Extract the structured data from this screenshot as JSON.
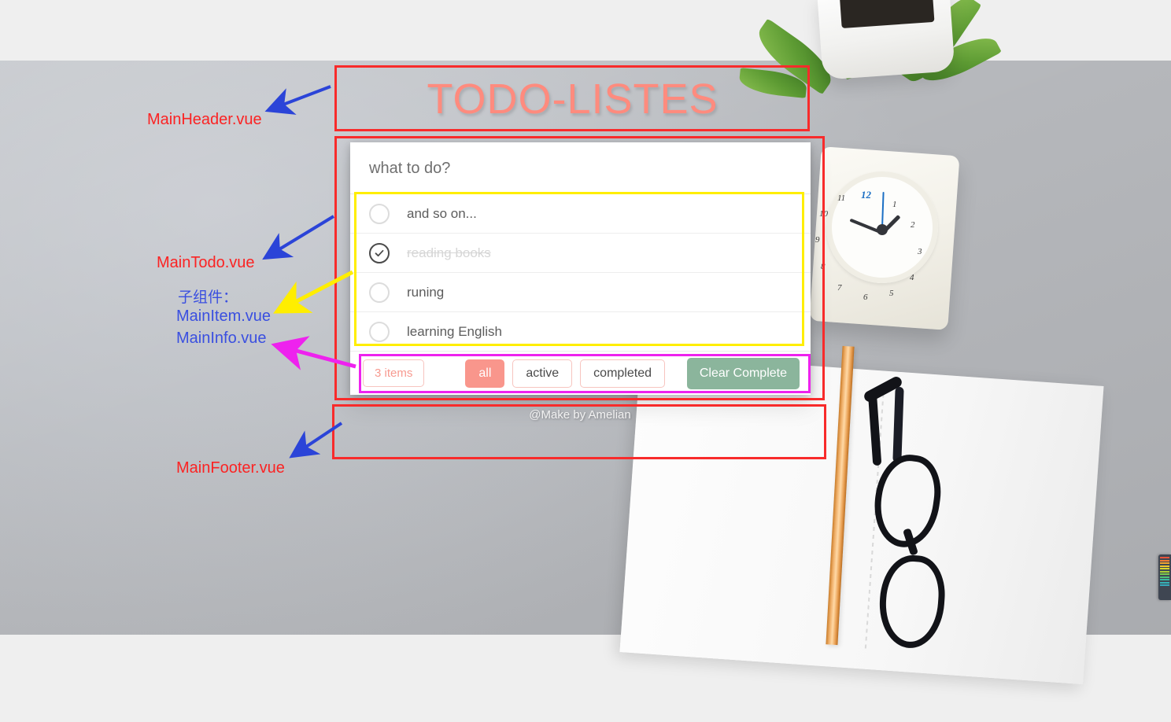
{
  "app": {
    "title": "TODO-LISTES",
    "credit": "@Make by Amelian"
  },
  "input": {
    "placeholder": "what to do?",
    "value": ""
  },
  "todos": [
    {
      "label": "and so on...",
      "done": false,
      "check_icon": "circle-empty-icon"
    },
    {
      "label": "reading books",
      "done": true,
      "check_icon": "circle-check-icon"
    },
    {
      "label": "runing",
      "done": false,
      "check_icon": "circle-empty-icon"
    },
    {
      "label": "learning English",
      "done": false,
      "check_icon": "circle-empty-icon"
    }
  ],
  "info": {
    "count_label": "3 items",
    "filters": [
      {
        "label": "all",
        "active": true
      },
      {
        "label": "active",
        "active": false
      },
      {
        "label": "completed",
        "active": false
      }
    ],
    "clear_label": "Clear Complete"
  },
  "annotations": {
    "header": "MainHeader.vue",
    "todo": "MainTodo.vue",
    "sub_title": "子组件：",
    "sub_item": "MainItem.vue",
    "sub_info": "MainInfo.vue",
    "footer": "MainFooter.vue"
  },
  "clock": {
    "numbers": [
      "12",
      "1",
      "2",
      "3",
      "4",
      "5",
      "6",
      "7",
      "8",
      "9",
      "10",
      "11"
    ]
  },
  "colors": {
    "accent_coral": "#f9968c",
    "accent_green": "#8bb59c",
    "title_coral": "#ff8b7e",
    "annotation_red": "#fb2323",
    "annotation_blue": "#3a4fe0",
    "annotation_yellow": "#ffee00",
    "annotation_magenta": "#ee22ee",
    "page_background": "#efefef"
  }
}
